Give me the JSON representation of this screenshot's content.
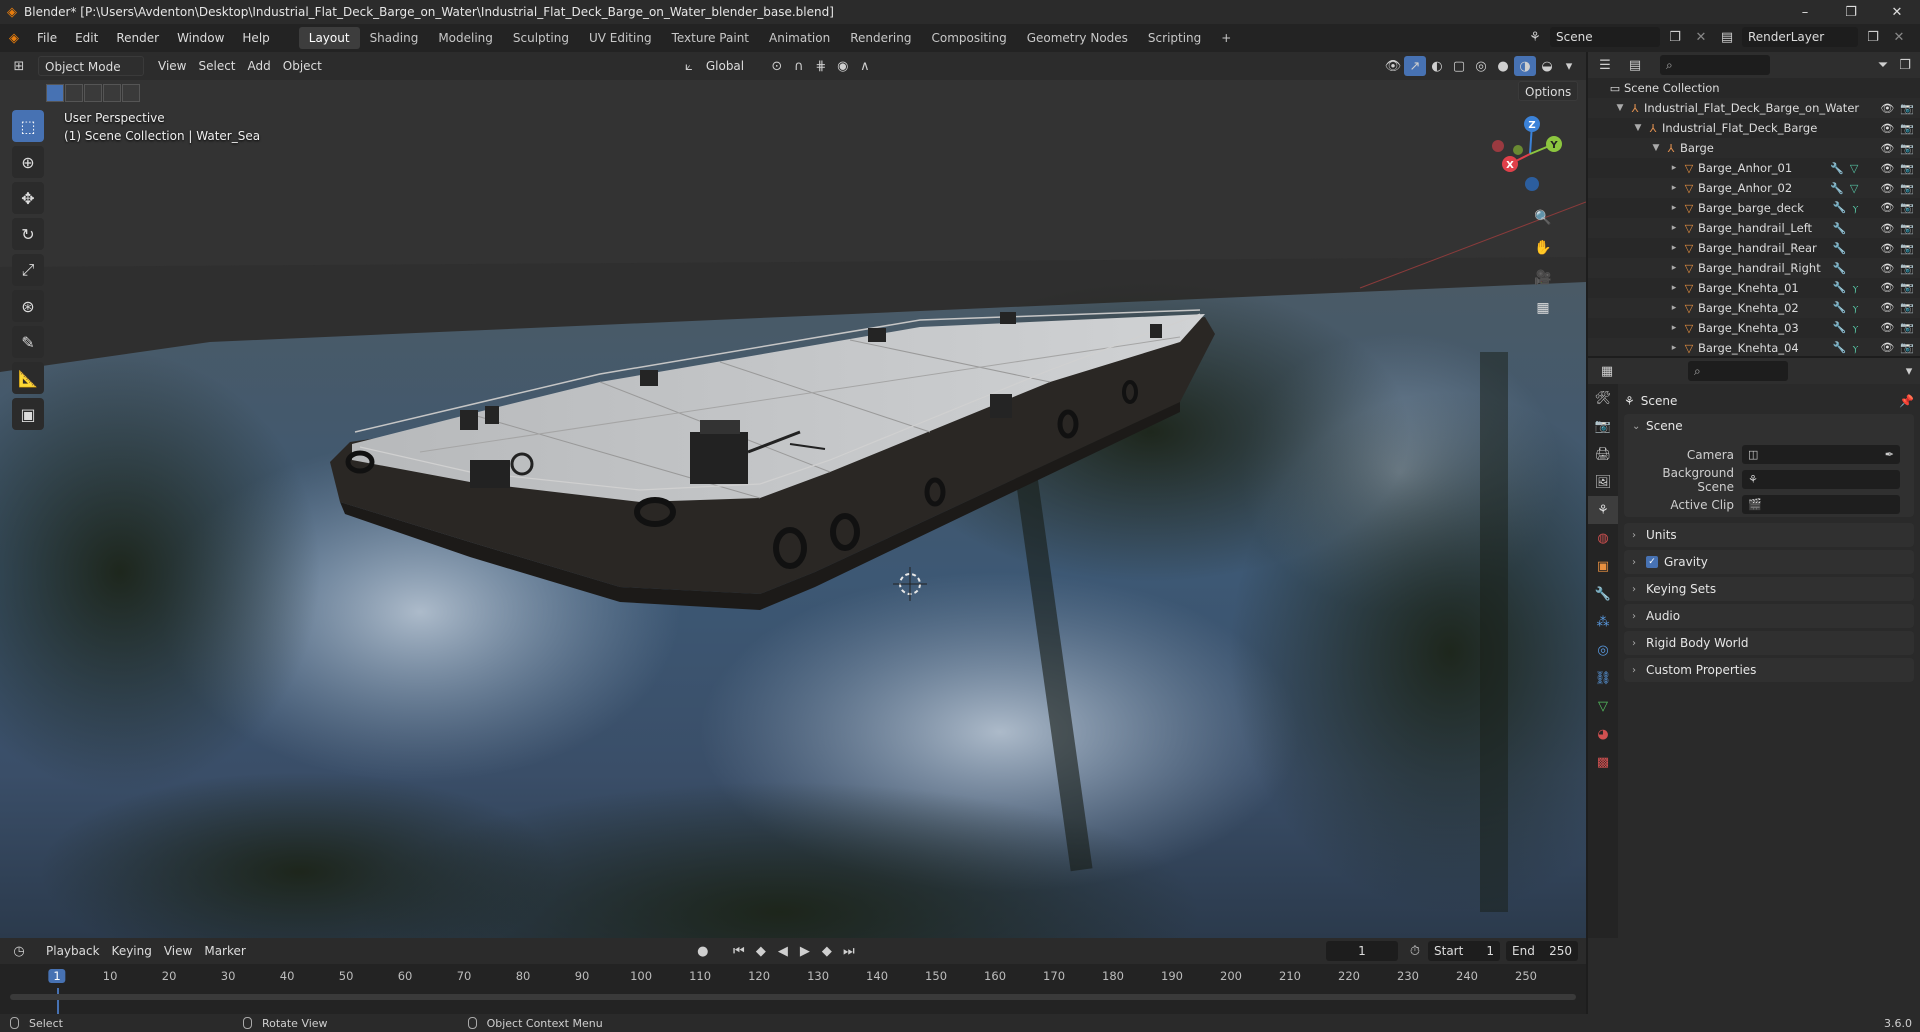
{
  "window": {
    "title": "Blender* [P:\\Users\\Avdenton\\Desktop\\Industrial_Flat_Deck_Barge_on_Water\\Industrial_Flat_Deck_Barge_on_Water_blender_base.blend]",
    "minimize": "–",
    "maximize": "❐",
    "close": "✕"
  },
  "menu": [
    "File",
    "Edit",
    "Render",
    "Window",
    "Help"
  ],
  "workspaces": [
    "Layout",
    "Shading",
    "Modeling",
    "Sculpting",
    "UV Editing",
    "Texture Paint",
    "Animation",
    "Rendering",
    "Compositing",
    "Geometry Nodes",
    "Scripting"
  ],
  "active_workspace": "Layout",
  "add_workspace": "+",
  "scene_selector": {
    "value": "Scene"
  },
  "view_layer": {
    "value": "RenderLayer"
  },
  "viewport": {
    "mode": "Object Mode",
    "menus": [
      "View",
      "Select",
      "Add",
      "Object"
    ],
    "transform_orientation": "Global",
    "options_label": "Options",
    "info_line1": "User Perspective",
    "info_line2": "(1) Scene Collection | Water_Sea",
    "gizmo": {
      "z": "Z",
      "y": "Y",
      "x": "X"
    }
  },
  "outliner": {
    "search_placeholder": "",
    "rows": [
      {
        "label": "Scene Collection",
        "depth": 0,
        "type": "collection",
        "expanded": ""
      },
      {
        "label": "Industrial_Flat_Deck_Barge_on_Water",
        "depth": 1,
        "type": "empty",
        "expanded": "▼"
      },
      {
        "label": "Industrial_Flat_Deck_Barge",
        "depth": 2,
        "type": "empty",
        "expanded": "▼"
      },
      {
        "label": "Barge",
        "depth": 3,
        "type": "empty",
        "expanded": "▼"
      },
      {
        "label": "Barge_Anhor_01",
        "depth": 4,
        "type": "mesh",
        "expanded": "▸"
      },
      {
        "label": "Barge_Anhor_02",
        "depth": 4,
        "type": "mesh",
        "expanded": "▸"
      },
      {
        "label": "Barge_barge_deck",
        "depth": 4,
        "type": "mesh",
        "expanded": "▸"
      },
      {
        "label": "Barge_handrail_Left",
        "depth": 4,
        "type": "mesh",
        "expanded": "▸"
      },
      {
        "label": "Barge_handrail_Rear",
        "depth": 4,
        "type": "mesh",
        "expanded": "▸"
      },
      {
        "label": "Barge_handrail_Right",
        "depth": 4,
        "type": "mesh",
        "expanded": "▸"
      },
      {
        "label": "Barge_Knehta_01",
        "depth": 4,
        "type": "mesh",
        "expanded": "▸"
      },
      {
        "label": "Barge_Knehta_02",
        "depth": 4,
        "type": "mesh",
        "expanded": "▸"
      },
      {
        "label": "Barge_Knehta_03",
        "depth": 4,
        "type": "mesh",
        "expanded": "▸"
      },
      {
        "label": "Barge_Knehta_04",
        "depth": 4,
        "type": "mesh",
        "expanded": "▸"
      }
    ]
  },
  "properties": {
    "breadcrumb": "Scene",
    "scene_panel": {
      "title": "Scene",
      "camera_label": "Camera",
      "camera_value": "",
      "background_label": "Background Scene",
      "background_value": "",
      "clip_label": "Active Clip",
      "clip_value": ""
    },
    "collapsed_panels": [
      "Units",
      "Gravity",
      "Keying Sets",
      "Audio",
      "Rigid Body World",
      "Custom Properties"
    ],
    "gravity_checked": "✓"
  },
  "timeline": {
    "menus": [
      "Playback",
      "Keying",
      "View",
      "Marker"
    ],
    "current_frame": "1",
    "start_label": "Start",
    "start_value": "1",
    "end_label": "End",
    "end_value": "250",
    "ticks": [
      "1",
      "10",
      "20",
      "30",
      "40",
      "50",
      "60",
      "70",
      "80",
      "90",
      "100",
      "110",
      "120",
      "130",
      "140",
      "150",
      "160",
      "170",
      "180",
      "190",
      "200",
      "210",
      "220",
      "230",
      "240",
      "250"
    ]
  },
  "statusbar": {
    "select": "Select",
    "rotate": "Rotate View",
    "context": "Object Context Menu",
    "version": "3.6.0"
  },
  "colors": {
    "accent": "#4772b3",
    "object_orange": "#e89040",
    "axis_x": "#e0404a",
    "axis_y": "#8cc63f",
    "axis_z": "#3b82d8"
  }
}
